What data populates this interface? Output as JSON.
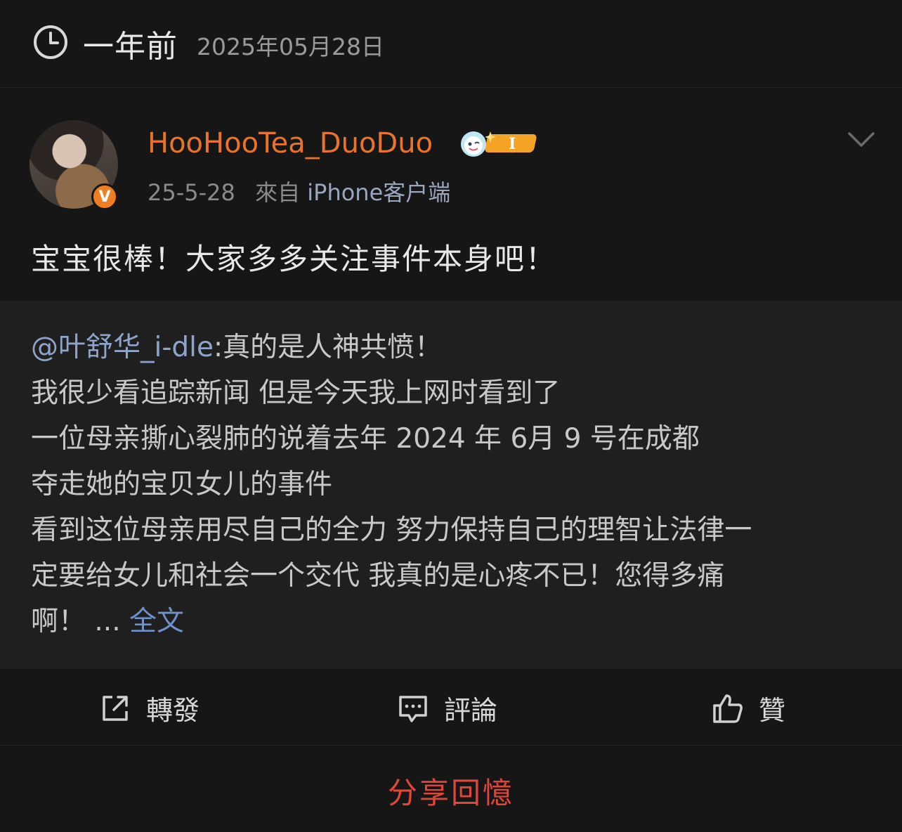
{
  "header": {
    "relative_time": "一年前",
    "date": "2025年05月28日"
  },
  "post": {
    "username": "HooHooTea_DuoDuo",
    "verified_badge": "V",
    "level_badge": "I",
    "timestamp": "25-5-28",
    "source_prefix": "來自",
    "source": "iPhone客户端",
    "content": "宝宝很棒！大家多多关注事件本身吧！"
  },
  "repost": {
    "mention": "@叶舒华_i-dle",
    "lines": [
      ":真的是人神共愤！",
      "我很少看追踪新闻 但是今天我上网时看到了",
      "一位母亲撕心裂肺的说着去年 2024 年 6月 9 号在成都",
      "夺走她的宝贝女儿的事件",
      "看到这位母亲用尽自己的全力 努力保持自己的理智让法律一",
      "定要给女儿和社会一个交代 我真的是心疼不已！您得多痛",
      "啊！ ... "
    ],
    "full_text_link": "全文"
  },
  "actions": {
    "repost_label": "轉發",
    "comment_label": "評論",
    "like_label": "贊"
  },
  "share": {
    "label": "分享回憶"
  },
  "icons": {
    "clock": "clock-icon",
    "chevron": "chevron-down-icon",
    "repost": "share-arrow-icon",
    "comment": "comment-icon",
    "like": "thumbs-up-icon"
  },
  "colors": {
    "username": "#e8732a",
    "link": "#6f90c8",
    "share": "#e0463a",
    "badge": "#f07d22"
  }
}
